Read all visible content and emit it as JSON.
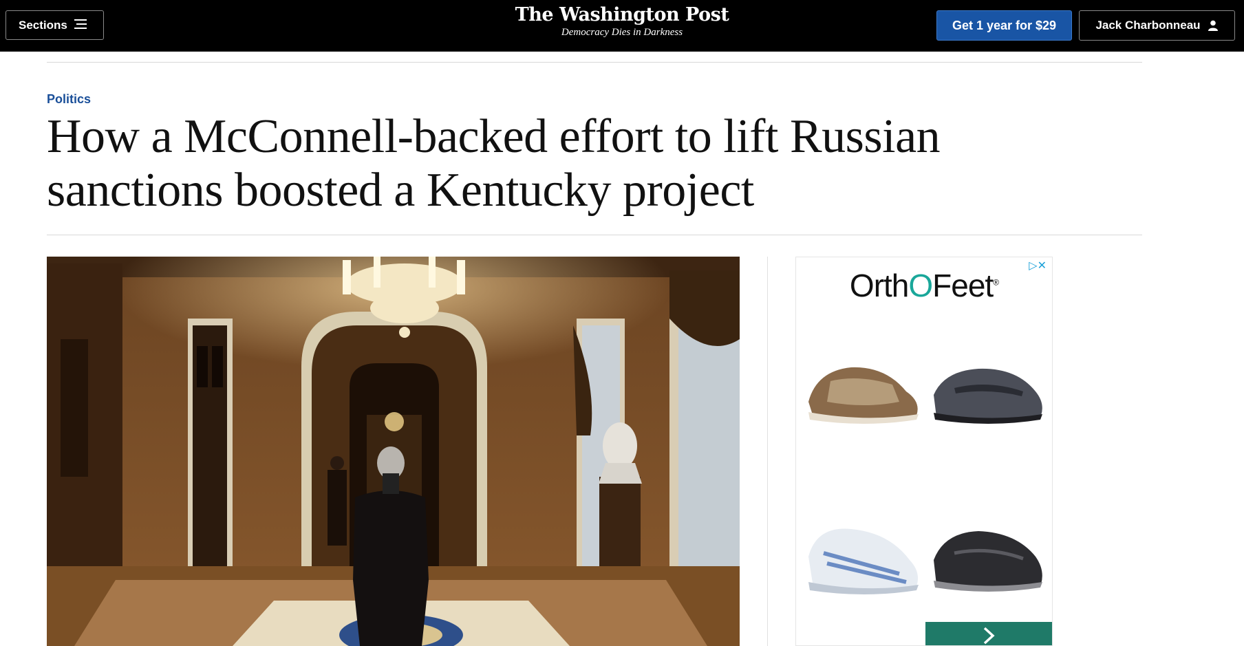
{
  "header": {
    "sections_label": "Sections",
    "logo": "The Washington Post",
    "tagline": "Democracy Dies in Darkness",
    "subscribe_label": "Get 1 year for $29",
    "account_label": "Jack Charbonneau"
  },
  "article": {
    "kicker": "Politics",
    "headline_line1": "How a McConnell-backed effort to lift Russian",
    "headline_line2": "sanctions boosted a Kentucky project"
  },
  "ad": {
    "brand_left": "Orth",
    "brand_mark": "O",
    "brand_right": "Feet",
    "registered": "®",
    "ad_choices": "▷✕",
    "products": [
      "sandal-shoe",
      "mary-jane-shoe",
      "sneaker-shoe",
      "slip-on-shoe"
    ]
  },
  "colors": {
    "topbar": "#000000",
    "subscribe": "#1955a5",
    "kicker": "#1a4f99",
    "ad_button": "#1f7a68"
  }
}
